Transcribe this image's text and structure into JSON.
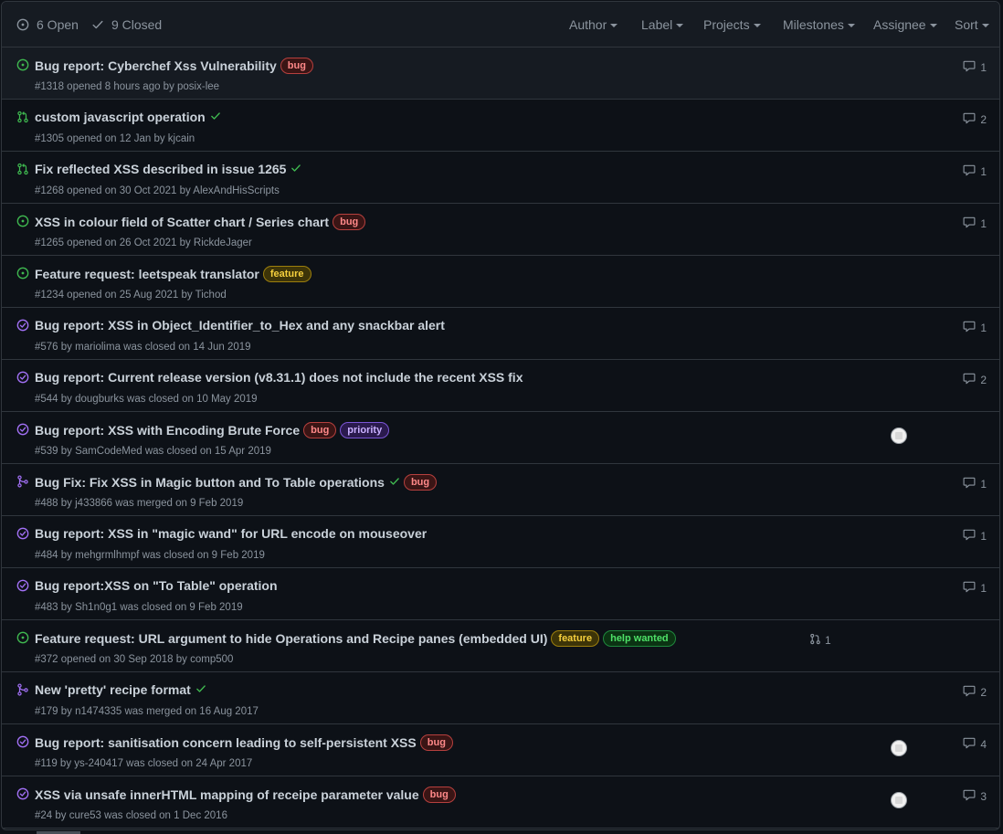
{
  "header": {
    "open_label": "6 Open",
    "closed_label": "9 Closed",
    "filters": [
      "Author",
      "Label",
      "Projects",
      "Milestones",
      "Assignee",
      "Sort"
    ]
  },
  "colors": {
    "open": "#3fb950",
    "closed": "#a371f7",
    "merged": "#a371f7",
    "muted": "#8b949e"
  },
  "items": [
    {
      "icon": "issue-open-icon",
      "title": "Bug report: Cyberchef Xss Vulnerability",
      "meta": "#1318 opened 8 hours ago by posix-lee",
      "labels": [
        "bug"
      ],
      "comments": "1"
    },
    {
      "icon": "pull-request-open-icon",
      "title": "custom javascript operation",
      "meta": "#1305 opened on 12 Jan by kjcain",
      "check": true,
      "comments": "2"
    },
    {
      "icon": "pull-request-open-icon",
      "title": "Fix reflected XSS described in issue 1265",
      "meta": "#1268 opened on 30 Oct 2021 by AlexAndHisScripts",
      "check": true,
      "comments": "1"
    },
    {
      "icon": "issue-open-icon",
      "title": "XSS in colour field of Scatter chart / Series chart",
      "meta": "#1265 opened on 26 Oct 2021 by RickdeJager",
      "labels": [
        "bug"
      ],
      "comments": "1"
    },
    {
      "icon": "issue-open-icon",
      "title": "Feature request: leetspeak translator",
      "meta": "#1234 opened on 25 Aug 2021 by Tichod",
      "labels": [
        "feature"
      ]
    },
    {
      "icon": "issue-closed-icon",
      "title": "Bug report: XSS in Object_Identifier_to_Hex and any snackbar alert",
      "meta": "#576 by mariolima was closed on 14 Jun 2019",
      "comments": "1"
    },
    {
      "icon": "issue-closed-icon",
      "title": "Bug report: Current release version (v8.31.1) does not include the recent XSS fix",
      "meta": "#544 by dougburks was closed on 10 May 2019",
      "comments": "2"
    },
    {
      "icon": "issue-closed-icon",
      "title": "Bug report: XSS with Encoding Brute Force",
      "meta": "#539 by SamCodeMed was closed on 15 Apr 2019",
      "labels": [
        "bug",
        "priority"
      ],
      "avatar": true
    },
    {
      "icon": "pull-request-merged-icon",
      "title": "Bug Fix: Fix XSS in Magic button and To Table operations",
      "meta": "#488 by j433866 was merged on 9 Feb 2019",
      "check": true,
      "labels": [
        "bug"
      ],
      "comments": "1"
    },
    {
      "icon": "issue-closed-icon",
      "title": "Bug report: XSS in \"magic wand\" for URL encode on mouseover",
      "meta": "#484 by mehgrmlhmpf was closed on 9 Feb 2019",
      "comments": "1"
    },
    {
      "icon": "issue-closed-icon",
      "title": "Bug report:XSS on \"To Table\" operation",
      "meta": "#483 by Sh1n0g1 was closed on 9 Feb 2019",
      "comments": "1"
    },
    {
      "icon": "issue-open-icon",
      "title": "Feature request: URL argument to hide Operations and Recipe panes (embedded UI)",
      "meta": "#372 opened on 30 Sep 2018 by comp500",
      "labels": [
        "feature",
        "help wanted"
      ],
      "linked_pr": "1"
    },
    {
      "icon": "pull-request-merged-icon",
      "title": "New 'pretty' recipe format",
      "meta": "#179 by n1474335 was merged on 16 Aug 2017",
      "check": true,
      "comments": "2"
    },
    {
      "icon": "issue-closed-icon",
      "title": "Bug report: sanitisation concern leading to self-persistent XSS",
      "meta": "#119 by ys-240417 was closed on 24 Apr 2017",
      "labels": [
        "bug"
      ],
      "avatar": true,
      "comments": "4"
    },
    {
      "icon": "issue-closed-icon",
      "title": "XSS via unsafe innerHTML mapping of receipe parameter value",
      "meta": "#24 by cure53 was closed on 1 Dec 2016",
      "labels": [
        "bug"
      ],
      "avatar": true,
      "comments": "3"
    }
  ]
}
